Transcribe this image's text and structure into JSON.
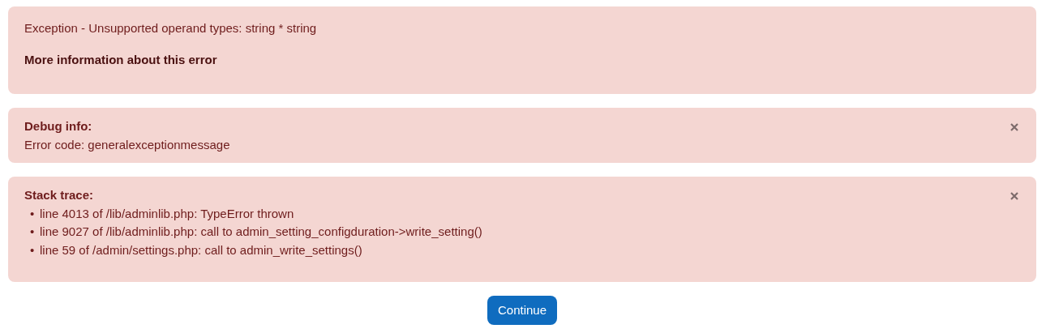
{
  "alerts": [
    {
      "kind": "message",
      "dismissible": false,
      "message": "Exception - Unsupported operand types: string * string",
      "link": "More information about this error"
    },
    {
      "kind": "debug",
      "dismissible": true,
      "title": "Debug info:",
      "lines": [
        "Error code: generalexceptionmessage"
      ]
    },
    {
      "kind": "trace",
      "dismissible": true,
      "title": "Stack trace:",
      "bullet": "•",
      "items": [
        "line 4013 of /lib/adminlib.php: TypeError thrown",
        "line 9027 of /lib/adminlib.php: call to admin_setting_configduration->write_setting()",
        "line 59 of /admin/settings.php: call to admin_write_settings()"
      ]
    }
  ],
  "continue_button": "Continue"
}
